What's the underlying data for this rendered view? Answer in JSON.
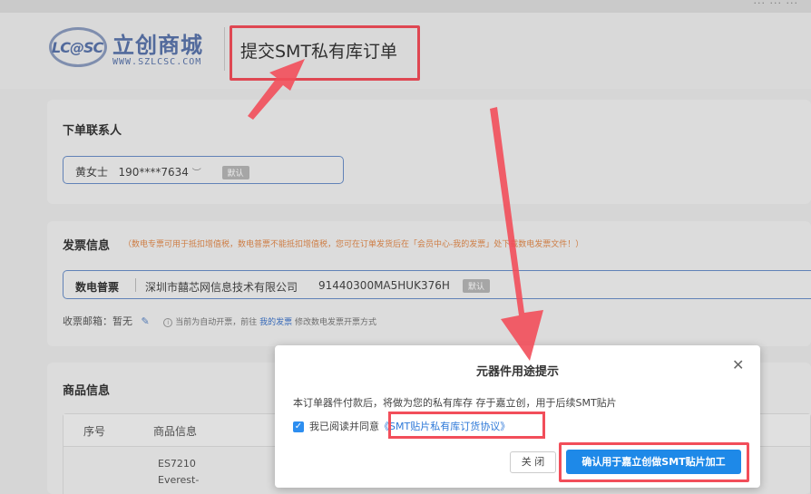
{
  "nav": {
    "links": "···  ···  ···"
  },
  "brand": {
    "logo_text": "LC@SC",
    "name": "立创商城",
    "url": "WWW.SZLCSC.COM"
  },
  "page": {
    "title": "提交SMT私有库订单"
  },
  "contact": {
    "section_title": "下单联系人",
    "name": "黄女士",
    "phone": "190****7634",
    "default_badge": "默认"
  },
  "invoice": {
    "section_title": "发票信息",
    "note": "（数电专票可用于抵扣增值税，数电普票不能抵扣增值税，您可在订单发货后在「会员中心-我的发票」处下载数电发票文件！）",
    "type": "数电普票",
    "company": "深圳市囍芯网信息技术有限公司",
    "tax_id": "91440300MA5HUK376H",
    "default_badge": "默认",
    "mail_label": "收票邮箱：暂无",
    "auto_note_prefix": "当前为自动开票，前往",
    "my_invoice_link": "我的发票",
    "auto_note_suffix": "修改数电发票开票方式"
  },
  "goods": {
    "section_title": "商品信息",
    "columns": [
      "序号",
      "商品信息"
    ],
    "rows": [
      {
        "part": "ES7210 Everest-"
      }
    ]
  },
  "modal": {
    "title": "元器件用途提示",
    "close_symbol": "✕",
    "message": "本订单器件付款后，将做为您的私有库存 存于嘉立创，用于后续SMT贴片",
    "agree_prefix": "我已阅读并同意",
    "agree_link": "《SMT贴片私有库订货协议》",
    "checked": true,
    "btn_close": "关 闭",
    "btn_confirm": "确认用于嘉立创做SMT贴片加工"
  },
  "colors": {
    "highlight": "#f24e5a",
    "primary": "#1e89e8",
    "brand": "#5a74aa"
  }
}
